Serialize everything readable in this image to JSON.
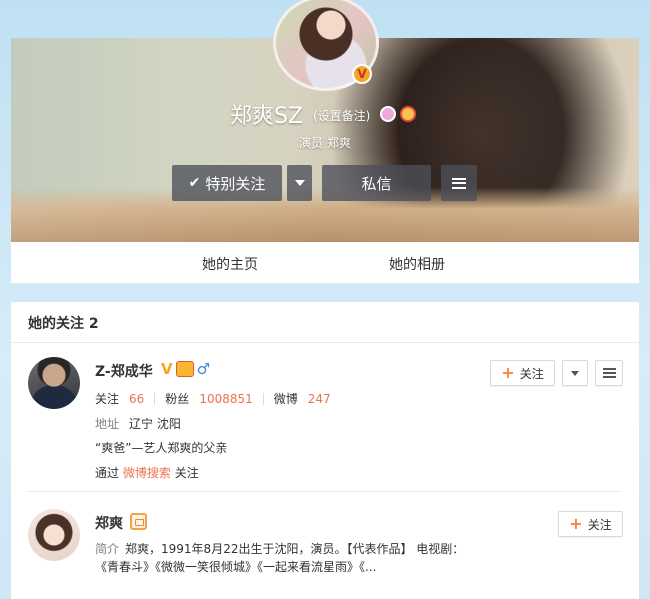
{
  "profile": {
    "name": "郑爽SZ",
    "set_remark": "(设置备注)",
    "verified_badge": "V",
    "subtitle": "演员 郑爽",
    "follow_button": "特别关注",
    "follow_check_icon": "check-icon",
    "message_button": "私信"
  },
  "tabs": [
    "她的主页",
    "她的相册"
  ],
  "following": {
    "title": "她的关注 2",
    "users": [
      {
        "name": "Z-郑成华",
        "verified": "V",
        "gender_icon": "♂",
        "stats": {
          "follow_label": "关注",
          "follow_count": "66",
          "fans_label": "粉丝",
          "fans_count": "1008851",
          "weibo_label": "微博",
          "weibo_count": "247"
        },
        "address_label": "地址",
        "address": "辽宁 沈阳",
        "description": "“爽爸”—艺人郑爽的父亲",
        "via_prefix": "通过",
        "via_link": "微博搜索",
        "via_suffix": "关注",
        "follow_button": "关注"
      },
      {
        "name": "郑爽",
        "intro_label": "简介",
        "intro": "郑爽，1991年8月22出生于沈阳，演员。【代表作品】 电视剧：《青春斗》《微微一笑很倾城》《一起来看流星雨》《...",
        "follow_button": "关注"
      }
    ]
  },
  "colors": {
    "accent_orange": "#eb7350",
    "plus_orange": "#ff8140",
    "verified_gold": "#f5a623",
    "male_blue": "#3a8be0"
  }
}
